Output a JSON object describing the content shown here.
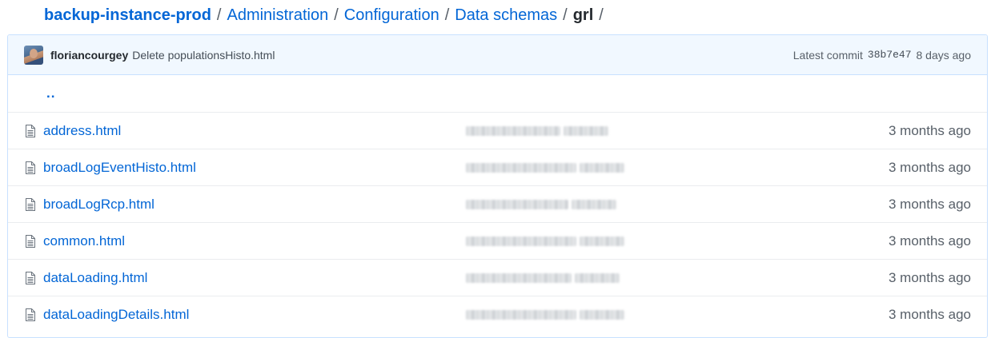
{
  "breadcrumb": {
    "repo": "backup-instance-prod",
    "segments": [
      "Administration",
      "Configuration",
      "Data schemas"
    ],
    "current": "grl",
    "separator": "/"
  },
  "commit": {
    "author": "floriancourgey",
    "message": "Delete populationsHisto.html",
    "label": "Latest commit",
    "sha": "38b7e47",
    "age": "8 days ago"
  },
  "up_link": "..",
  "files": [
    {
      "name": "address.html",
      "age": "3 months ago"
    },
    {
      "name": "broadLogEventHisto.html",
      "age": "3 months ago"
    },
    {
      "name": "broadLogRcp.html",
      "age": "3 months ago"
    },
    {
      "name": "common.html",
      "age": "3 months ago"
    },
    {
      "name": "dataLoading.html",
      "age": "3 months ago"
    },
    {
      "name": "dataLoadingDetails.html",
      "age": "3 months ago"
    }
  ],
  "icons": {
    "file": "file-icon",
    "avatar": "avatar"
  },
  "colors": {
    "link": "#0366d6",
    "commit_bar_bg": "#f1f8ff",
    "border": "#c8e1ff"
  }
}
